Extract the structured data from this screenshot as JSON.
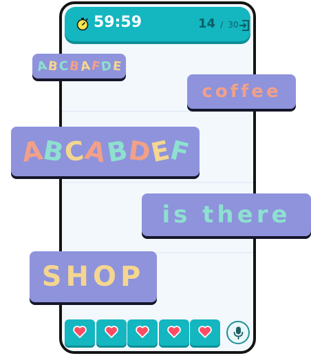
{
  "header": {
    "timer": "59:59",
    "progress_current": "14",
    "progress_separator": "/",
    "progress_total": "30",
    "icons": [
      "stopwatch-icon",
      "exit-icon"
    ]
  },
  "tiles": [
    {
      "text": "ABCBAFDE",
      "letter_colors": [
        "#8ee0d0",
        "#f4d690",
        "#8ee0d0",
        "#f2a089",
        "#f4d690",
        "#f2a089",
        "#8ee0d0",
        "#f4d690"
      ]
    },
    {
      "text": "coffee"
    },
    {
      "text": "ABCABDEF",
      "letter_colors": [
        "#f2a089",
        "#8ee0d0",
        "#f4d690",
        "#f2a089",
        "#8ee0d0",
        "#f2a089",
        "#f4d690",
        "#8ee0d0"
      ]
    },
    {
      "text": "is there"
    },
    {
      "text": "SHOP"
    }
  ],
  "lives": {
    "count": 5,
    "icon": "heart-icon",
    "color": "#ff4b63"
  },
  "mic": {
    "icon": "microphone-icon"
  },
  "colors": {
    "accent": "#14b6c0",
    "tile": "#8e93dc",
    "tile_shadow": "#16162a"
  }
}
